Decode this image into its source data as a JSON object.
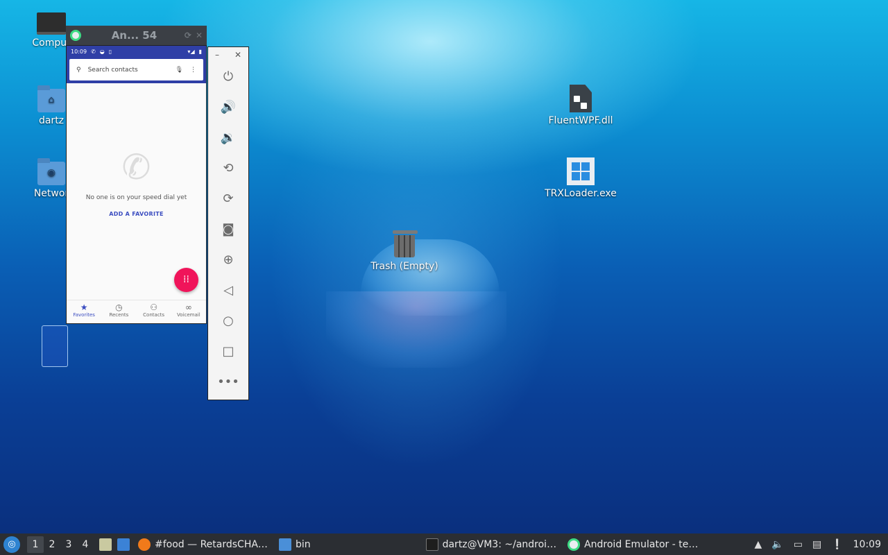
{
  "desktop": {
    "icons_left": [
      {
        "label": "Comput",
        "icon": "computer-icon"
      },
      {
        "label": "dartz",
        "icon": "home-folder-icon"
      },
      {
        "label": "Networ",
        "icon": "network-folder-icon"
      }
    ],
    "icons_right": [
      {
        "label": "FluentWPF.dll",
        "icon": "dll-file-icon"
      },
      {
        "label": "TRXLoader.exe",
        "icon": "windows-exe-icon"
      },
      {
        "label": "Trash (Empty)",
        "icon": "trash-icon"
      }
    ]
  },
  "emulator": {
    "title": "An... 54",
    "statusbar": {
      "time": "10:09"
    },
    "search": {
      "placeholder": "Search contacts"
    },
    "empty_message": "No one is on your speed dial yet",
    "add_favorite": "ADD A FAVORITE",
    "bottom_nav": [
      {
        "label": "Favorites",
        "icon": "star-icon",
        "active": true
      },
      {
        "label": "Recents",
        "icon": "clock-icon",
        "active": false
      },
      {
        "label": "Contacts",
        "icon": "people-icon",
        "active": false
      },
      {
        "label": "Voicemail",
        "icon": "voicemail-icon",
        "active": false
      }
    ],
    "side_controls": [
      "power-icon",
      "volume-up-icon",
      "volume-down-icon",
      "rotate-left-icon",
      "rotate-right-icon",
      "camera-icon",
      "zoom-icon",
      "back-icon",
      "home-icon",
      "overview-icon",
      "more-icon"
    ]
  },
  "taskbar": {
    "workspaces": [
      "1",
      "2",
      "3",
      "4"
    ],
    "tasks": [
      {
        "label": "#food — RetardsCHA…",
        "icon": "firefox-icon"
      },
      {
        "label": "bin",
        "icon": "folder-icon"
      },
      {
        "label": "dartz@VM3: ~/androi…",
        "icon": "terminal-icon"
      },
      {
        "label": "Android Emulator - te…",
        "icon": "android-emulator-icon"
      }
    ],
    "clock": "10:09"
  }
}
